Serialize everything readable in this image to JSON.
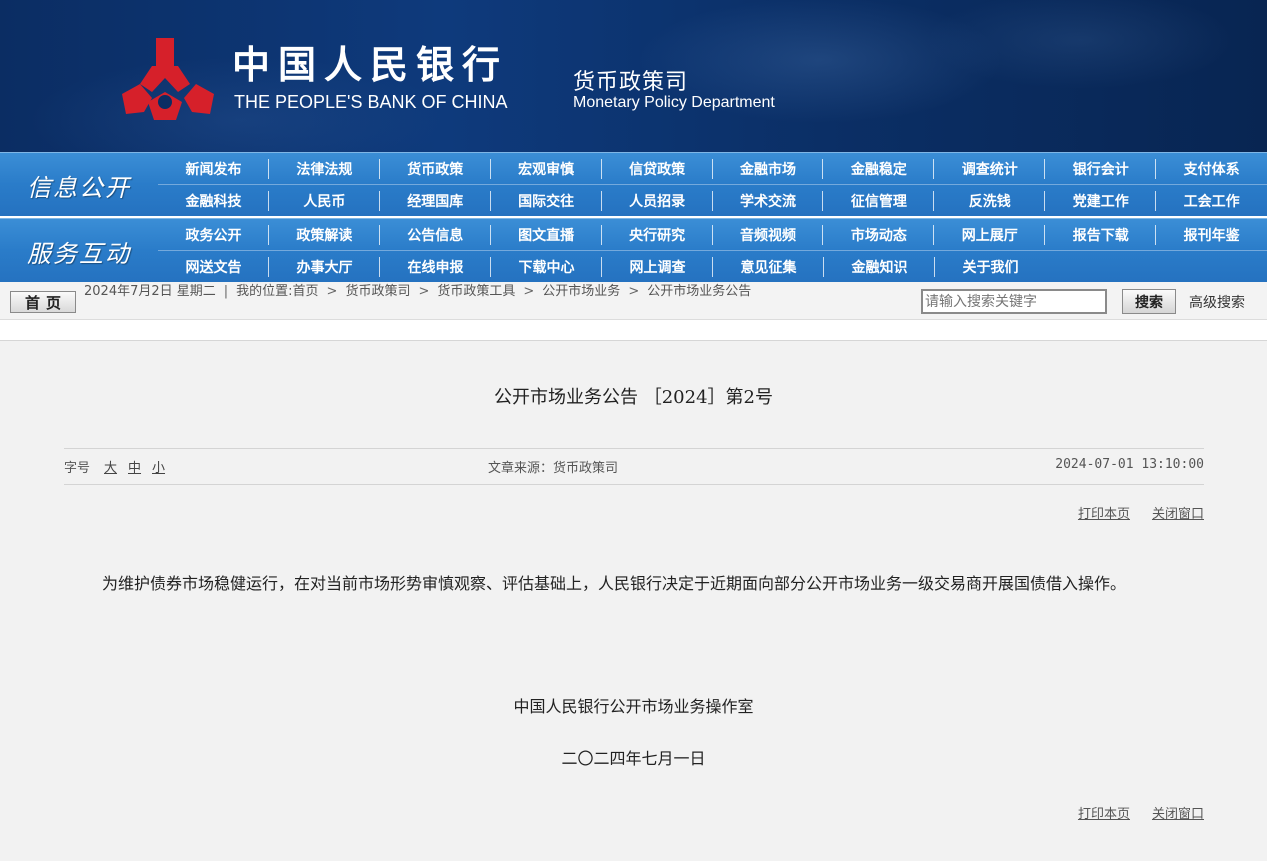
{
  "banner": {
    "bank_name_cn": "中国人民银行",
    "bank_name_en": "THE PEOPLE'S BANK OF CHINA",
    "dept_cn": "货币政策司",
    "dept_en": "Monetary Policy Department",
    "logo_icon": "pboc-emblem-icon",
    "logo_color": "#d6202a"
  },
  "nav": {
    "section1_title": "信息公开",
    "section1_row1": [
      "新闻发布",
      "法律法规",
      "货币政策",
      "宏观审慎",
      "信贷政策",
      "金融市场",
      "金融稳定",
      "调查统计",
      "银行会计",
      "支付体系"
    ],
    "section1_row2": [
      "金融科技",
      "人民币",
      "经理国库",
      "国际交往",
      "人员招录",
      "学术交流",
      "征信管理",
      "反洗钱",
      "党建工作",
      "工会工作"
    ],
    "section2_title": "服务互动",
    "section2_row1": [
      "政务公开",
      "政策解读",
      "公告信息",
      "图文直播",
      "央行研究",
      "音频视频",
      "市场动态",
      "网上展厅",
      "报告下载",
      "报刊年鉴"
    ],
    "section2_row2": [
      "网送文告",
      "办事大厅",
      "在线申报",
      "下载中心",
      "网上调查",
      "意见征集",
      "金融知识",
      "关于我们"
    ]
  },
  "crumb": {
    "home": "首页",
    "date": "2024年7月2日 星期二",
    "location_label": "我的位置:首页",
    "path": [
      "货币政策司",
      "货币政策工具",
      "公开市场业务",
      "公开市场业务公告"
    ],
    "search_placeholder": "请输入搜索关键字",
    "search_button": "搜索",
    "advanced_search": "高级搜索"
  },
  "article": {
    "title": "公开市场业务公告 ［2024］第2号",
    "font_size_label": "字号",
    "font_sizes": [
      "大",
      "中",
      "小"
    ],
    "source": "文章来源：货币政策司",
    "pub_time": "2024-07-01 13:10:00",
    "print_label": "打印本页",
    "close_label": "关闭窗口",
    "body": "为维护债券市场稳健运行，在对当前市场形势审慎观察、评估基础上，人民银行决定于近期面向部分公开市场业务一级交易商开展国债借入操作。",
    "signature": "中国人民银行公开市场业务操作室",
    "sign_date": "二〇二四年七月一日"
  }
}
